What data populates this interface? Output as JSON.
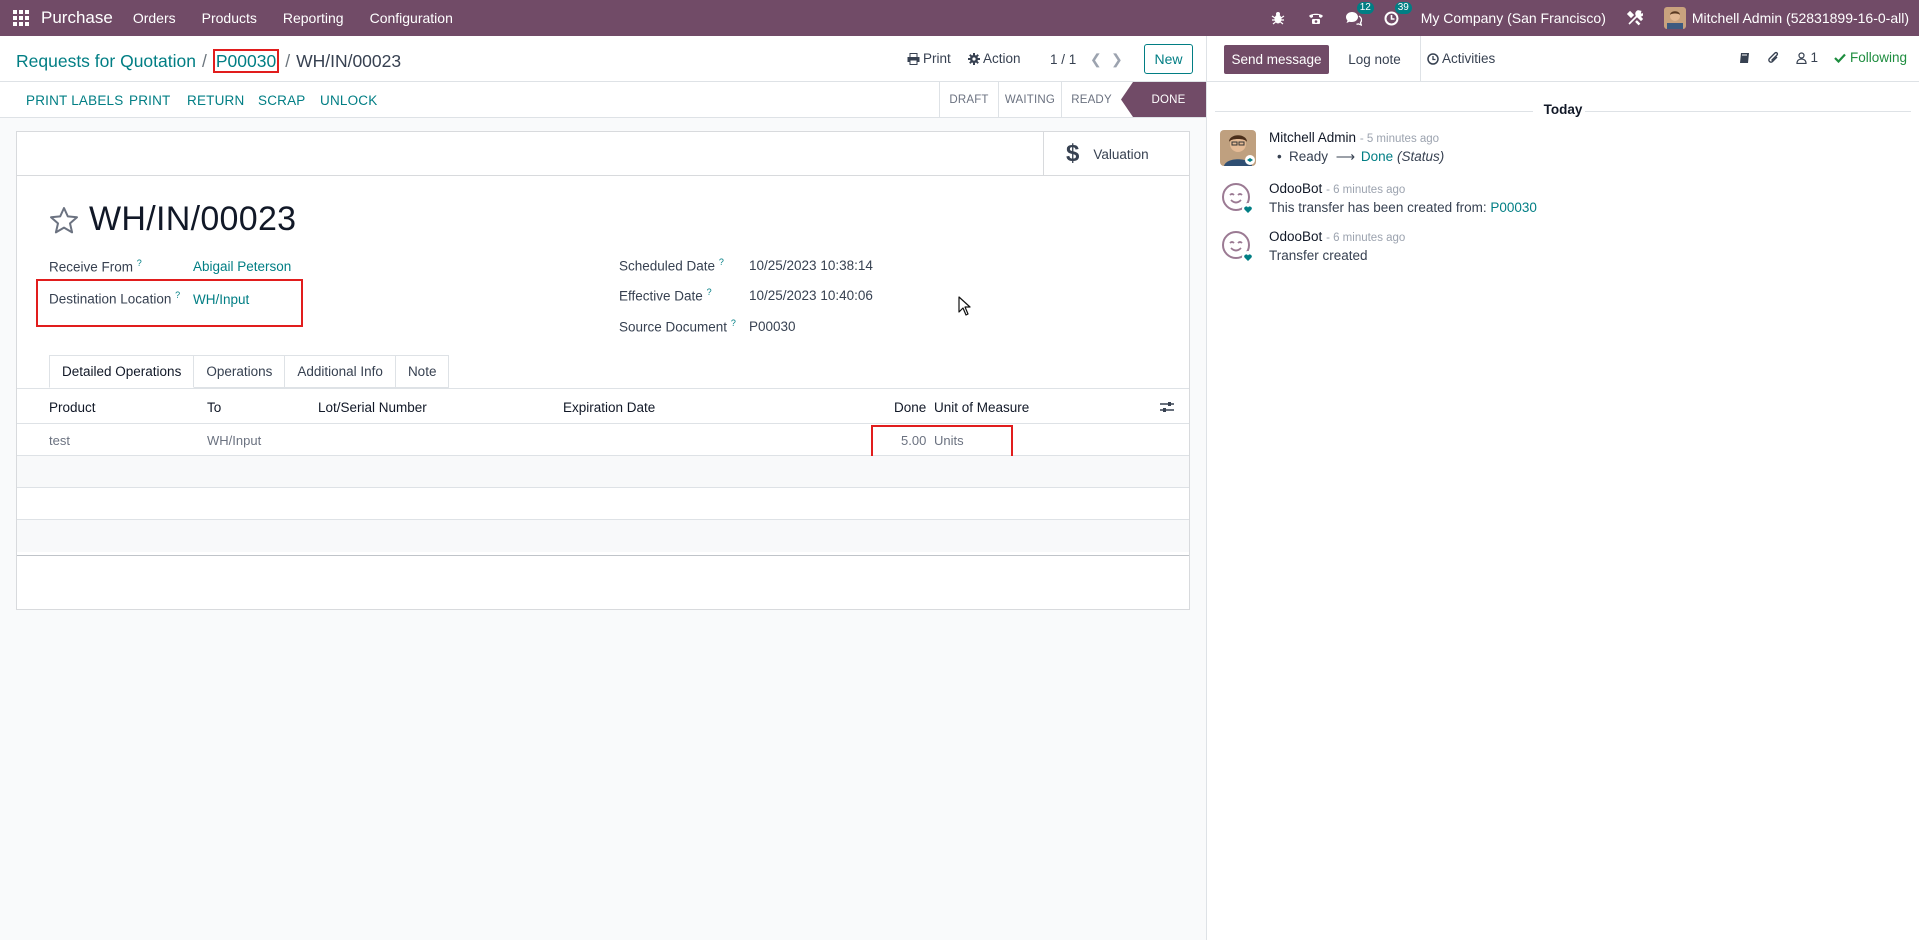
{
  "navbar": {
    "app_name": "Purchase",
    "menu": [
      "Orders",
      "Products",
      "Reporting",
      "Configuration"
    ],
    "messages_count": "12",
    "activities_count": "39",
    "company": "My Company (San Francisco)",
    "user": "Mitchell Admin (52831899-16-0-all)"
  },
  "breadcrumb": {
    "root": "Requests for Quotation",
    "sep1": "/",
    "middle": "P00030",
    "sep2": "/",
    "current": "WH/IN/00023"
  },
  "control": {
    "print": "Print",
    "action": "Action",
    "pager": "1 / 1",
    "new": "New"
  },
  "statusbar": {
    "buttons": [
      "PRINT LABELS",
      "PRINT",
      "RETURN",
      "SCRAP",
      "UNLOCK"
    ],
    "stages": [
      "DRAFT",
      "WAITING",
      "READY",
      "DONE"
    ],
    "current_stage": "DONE"
  },
  "valuation": "Valuation",
  "record": {
    "title": "WH/IN/00023",
    "receive_from_label": "Receive From",
    "receive_from": "Abigail Peterson",
    "destination_label": "Destination Location",
    "destination": "WH/Input",
    "scheduled_label": "Scheduled Date",
    "scheduled": "10/25/2023 10:38:14",
    "effective_label": "Effective Date",
    "effective": "10/25/2023 10:40:06",
    "source_label": "Source Document",
    "source": "P00030",
    "help_mark": "?"
  },
  "tabs": [
    "Detailed Operations",
    "Operations",
    "Additional Info",
    "Note"
  ],
  "table": {
    "headers": {
      "product": "Product",
      "to": "To",
      "lot": "Lot/Serial Number",
      "expiration": "Expiration Date",
      "done": "Done",
      "uom": "Unit of Measure"
    },
    "rows": [
      {
        "product": "test",
        "to": "WH/Input",
        "lot": "",
        "expiration": "",
        "done": "5.00",
        "uom": "Units"
      }
    ]
  },
  "chatter": {
    "send_message": "Send message",
    "log_note": "Log note",
    "activities": "Activities",
    "followers_count": "1",
    "following": "Following",
    "day": "Today",
    "messages": [
      {
        "author": "Mitchell Admin",
        "time": "- 5 minutes ago",
        "from": "Ready",
        "to": "Done",
        "field": "(Status)"
      },
      {
        "author": "OdooBot",
        "time": "- 6 minutes ago",
        "body": "This transfer has been created from:",
        "link": "P00030"
      },
      {
        "author": "OdooBot",
        "time": "- 6 minutes ago",
        "body": "Transfer created"
      }
    ]
  },
  "colors": {
    "brand": "#714b67",
    "link": "#017e84",
    "highlight": "#e11d1d",
    "following": "#1e8d3f"
  }
}
